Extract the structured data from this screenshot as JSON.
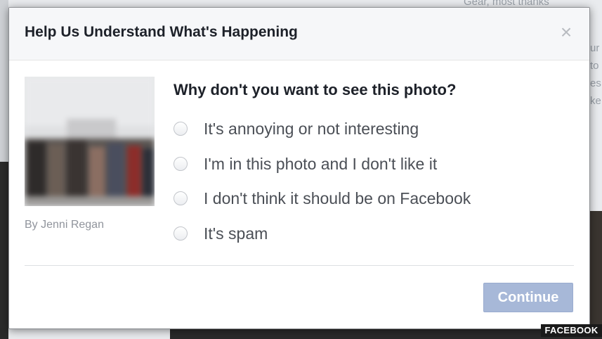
{
  "background": {
    "partial_text_top": "Gear, most thanks",
    "partial_text_right": [
      "ur",
      "to",
      "es",
      "ke"
    ]
  },
  "dialog": {
    "title": "Help Us Understand What's Happening",
    "close_icon": "close-icon",
    "photo_credit": "By Jenni Regan",
    "question": "Why don't you want to see this photo?",
    "options": [
      {
        "label": "It's annoying or not interesting",
        "selected": false
      },
      {
        "label": "I'm in this photo and I don't like it",
        "selected": false
      },
      {
        "label": "I don't think it should be on Facebook",
        "selected": false
      },
      {
        "label": "It's spam",
        "selected": false
      }
    ],
    "continue_label": "Continue"
  },
  "watermark": "FACEBOOK",
  "colors": {
    "button_disabled": "#a7b8d8",
    "title_text": "#1d2129",
    "option_text": "#4b4f56",
    "credit_text": "#90949c"
  }
}
